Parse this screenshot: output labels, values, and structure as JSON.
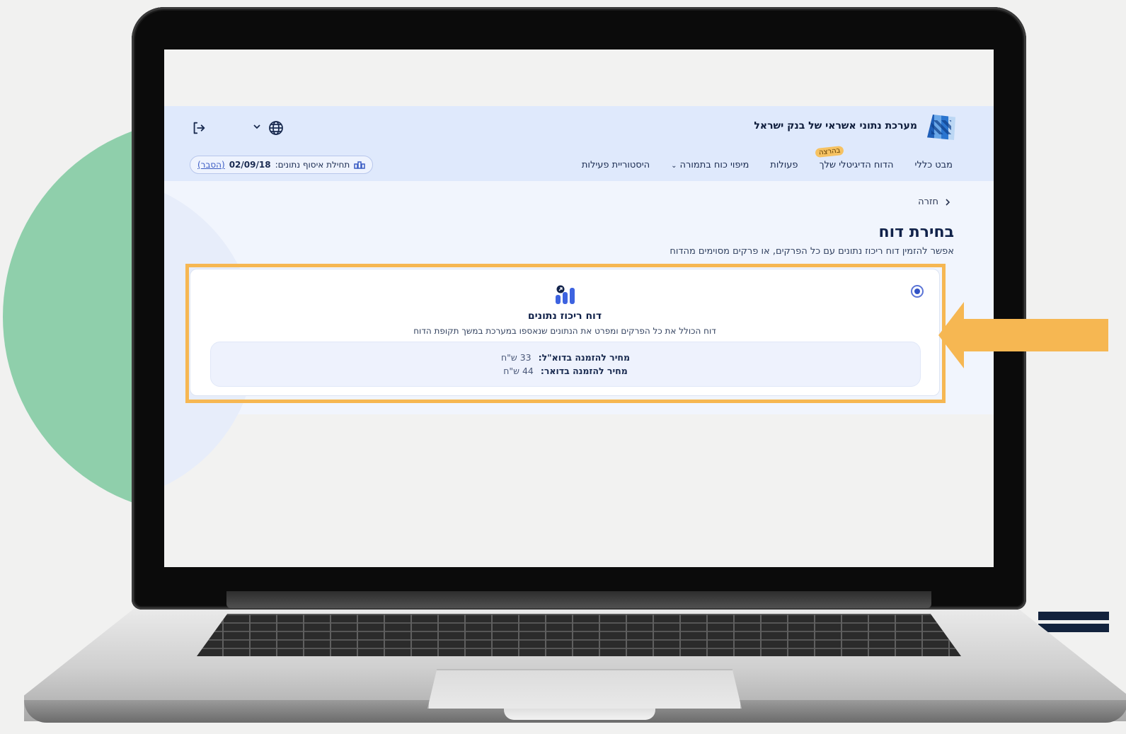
{
  "site": {
    "title": "מערכת נתוני אשראי של בנק ישראל"
  },
  "nav": {
    "items": [
      {
        "label": "מבט כללי"
      },
      {
        "label": "הדוח הדיגיטלי שלך",
        "badge": "בהרצה"
      },
      {
        "label": "פעולות"
      },
      {
        "label": "מיפוי כוח בתמורה",
        "chevron": "⌄"
      },
      {
        "label": "היסטוריית פעילות"
      }
    ]
  },
  "data_collection": {
    "label": "תחילת איסוף נתונים:",
    "date": "02/09/18",
    "link": "(הסבר)"
  },
  "back": {
    "label": "חזרה",
    "icon": "chevron-right-icon"
  },
  "page": {
    "title": "בחירת דוח",
    "subtitle": "אפשר להזמין דוח ריכוז נתונים עם כל הפרקים, או פרקים מסוימים מהדוח"
  },
  "report": {
    "title": "דוח ריכוז נתונים",
    "description": "דוח הכולל את כל הפרקים ומפרט את הנתונים שנאספו במערכת במשך תקופת הדוח",
    "selected": true,
    "prices": [
      {
        "label": "מחיר להזמנה בדוא\"ל:",
        "value": "33 ש\"ח"
      },
      {
        "label": "מחיר להזמנה בדואר:",
        "value": "44 ש\"ח"
      }
    ]
  },
  "colors": {
    "accent": "#f6b752",
    "brand": "#3153c6",
    "header_bg": "#dfe9fc",
    "circle": "#8fcfab"
  }
}
